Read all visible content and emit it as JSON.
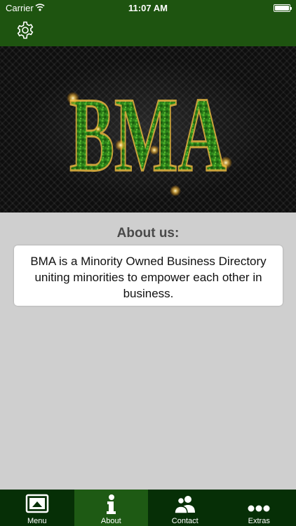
{
  "status_bar": {
    "carrier": "Carrier",
    "time": "11:07 AM"
  },
  "header": {
    "settings_icon": "gear-icon"
  },
  "banner": {
    "logo_text": "BMA"
  },
  "about": {
    "title": "About us:",
    "description": "BMA is a Minority Owned Business Directory uniting minorities to empower each other in business."
  },
  "tabs": [
    {
      "label": "Menu",
      "icon": "menu-icon",
      "active": false
    },
    {
      "label": "About",
      "icon": "info-icon",
      "active": true
    },
    {
      "label": "Contact",
      "icon": "contact-icon",
      "active": false
    },
    {
      "label": "Extras",
      "icon": "more-icon",
      "active": false
    }
  ],
  "colors": {
    "header": "#1e5410",
    "tab_bar": "#062f06",
    "tab_active": "#1e5a14",
    "page_bg": "#cfcfcf",
    "logo_green": "#2d8a1c",
    "logo_gold": "#c9a23a"
  }
}
